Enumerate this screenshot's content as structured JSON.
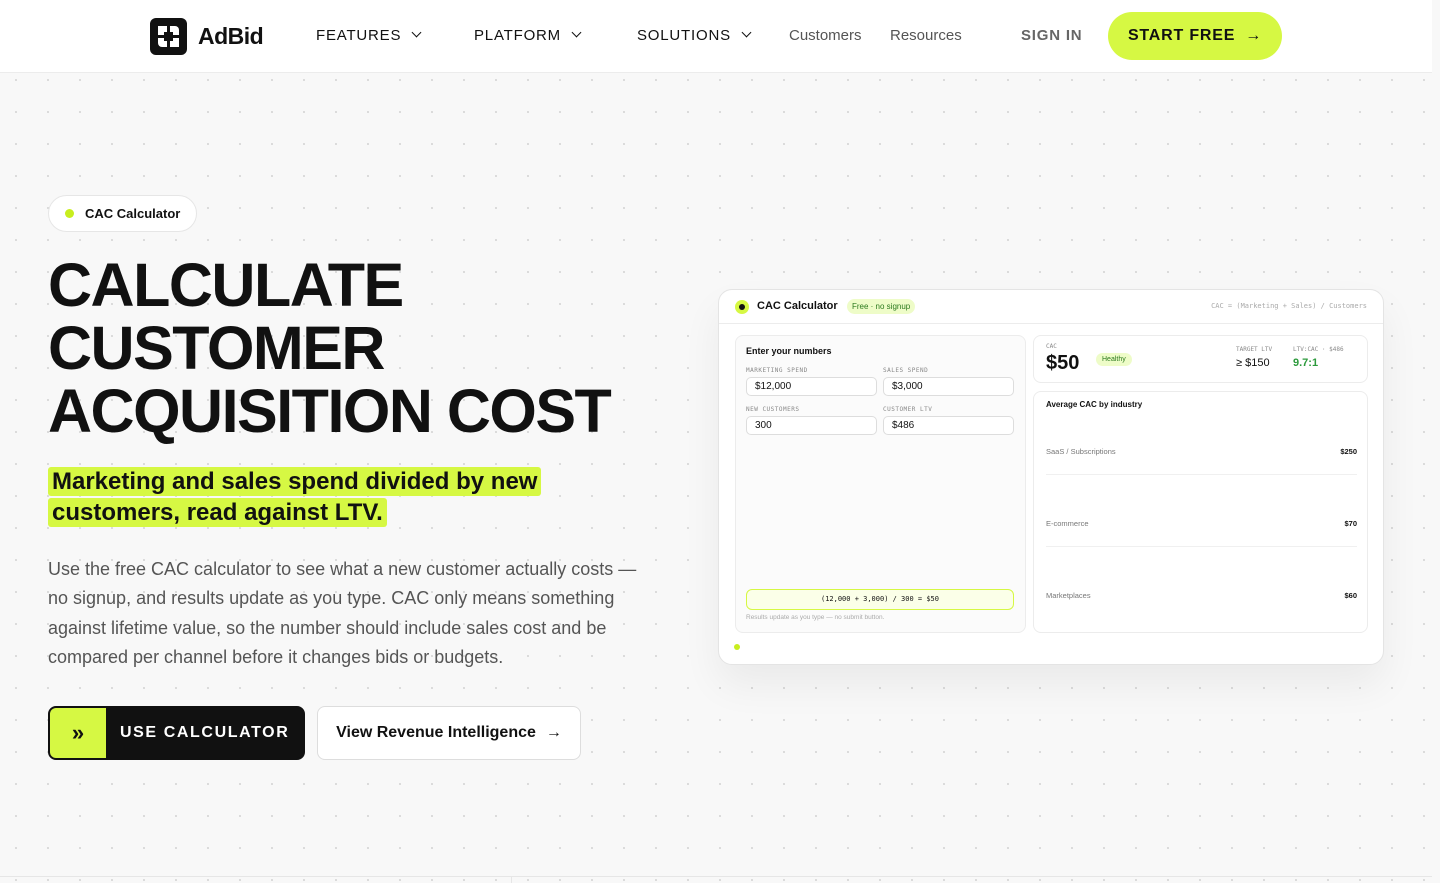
{
  "nav": {
    "brand": "AdBid",
    "features": "FEATURES",
    "platform": "PLATFORM",
    "solutions": "SOLUTIONS",
    "customers": "Customers",
    "resources": "Resources",
    "sign_in": "SIGN IN",
    "start_free": "START FREE"
  },
  "hero": {
    "pill": "CAC Calculator",
    "headline_1": "Calculate",
    "headline_2": "customer",
    "headline_3": "acquisition cost",
    "subhead": "Marketing and sales spend divided by new customers, read against LTV.",
    "body": "Use the free CAC calculator to see what a new customer actually costs — no signup, and results update as you type. CAC only means something against lifetime value, so the number should include sales cost and be compared per channel before it changes bids or budgets.",
    "primary_cta": "USE CALCULATOR",
    "secondary_cta": "View Revenue Intelligence"
  },
  "card": {
    "title": "CAC Calculator",
    "badge": "Free · no signup",
    "formula": "CAC = (Marketing + Sales) / Customers",
    "inputs_title": "Enter your numbers",
    "fields": {
      "marketing_label": "MARKETING SPEND",
      "marketing_value": "$12,000",
      "sales_label": "SALES SPEND",
      "sales_value": "$3,000",
      "customers_label": "NEW CUSTOMERS",
      "customers_value": "300",
      "ltv_label": "CUSTOMER LTV",
      "ltv_value": "$486"
    },
    "result": "(12,000 + 3,000) / 300 = $50",
    "result_note": "Results update as you type — no submit button.",
    "cac_label": "CAC",
    "cac_value": "$50",
    "cac_status": "Healthy",
    "target_label": "TARGET LTV",
    "target_value": "≥ $150",
    "ratio_label": "LTV:CAC · $486",
    "ratio_value": "9.7:1",
    "industry_title": "Average CAC by industry",
    "industries": [
      {
        "name": "SaaS / Subscriptions",
        "value": "$250"
      },
      {
        "name": "E-commerce",
        "value": "$70"
      },
      {
        "name": "Marketplaces",
        "value": "$60"
      }
    ]
  },
  "colors": {
    "accent": "#d6f843",
    "dark": "#111111",
    "success": "#2c9a3c"
  }
}
